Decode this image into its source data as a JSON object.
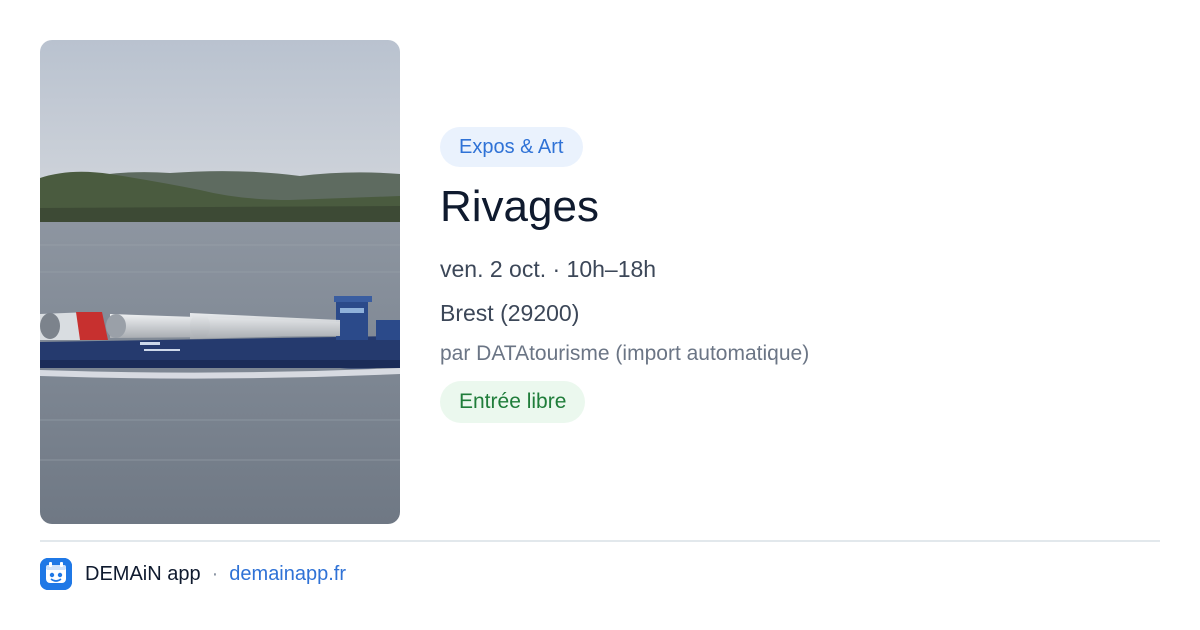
{
  "event": {
    "image_alt": "Cargo ship carrying wind turbine blades along the coast",
    "category": "Expos & Art",
    "title": "Rivages",
    "datetime": "ven. 2 oct. · 10h–18h",
    "location": "Brest (29200)",
    "source": "par DATAtourisme (import automatique)",
    "price": "Entrée libre"
  },
  "footer": {
    "app_icon": "app-logo-icon",
    "app_name": "DEMAiN app",
    "separator": "·",
    "site": "demainapp.fr"
  },
  "colors": {
    "category_chip_bg": "#eaf2fd",
    "category_chip_text": "#2f72d6",
    "price_chip_bg": "#ebf8ee",
    "price_chip_text": "#1f7d3a",
    "title_text": "#0f1a2e",
    "link": "#2f72d6"
  }
}
